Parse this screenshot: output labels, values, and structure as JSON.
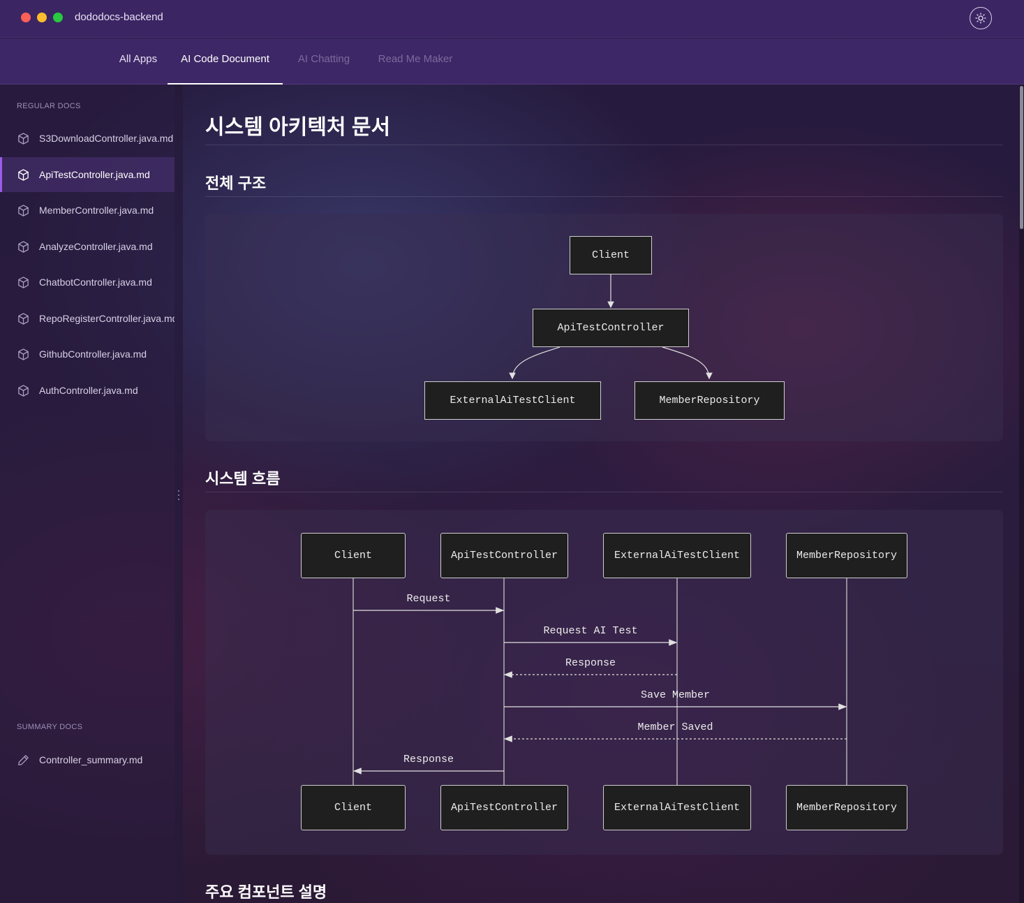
{
  "window": {
    "title": "dododocs-backend"
  },
  "nav": {
    "tabs": [
      {
        "label": "All Apps"
      },
      {
        "label": "AI Code Document"
      },
      {
        "label": "AI Chatting"
      },
      {
        "label": "Read Me Maker"
      }
    ],
    "active_tab": "AI Code Document"
  },
  "sidebar": {
    "regular_label": "REGULAR DOCS",
    "regular_items": [
      {
        "label": "S3DownloadController.java.md"
      },
      {
        "label": "ApiTestController.java.md"
      },
      {
        "label": "MemberController.java.md"
      },
      {
        "label": "AnalyzeController.java.md"
      },
      {
        "label": "ChatbotController.java.md"
      },
      {
        "label": "RepoRegisterController.java.md"
      },
      {
        "label": "GithubController.java.md"
      },
      {
        "label": "AuthController.java.md"
      }
    ],
    "active_item": "ApiTestController.java.md",
    "summary_label": "SUMMARY DOCS",
    "summary_items": [
      {
        "label": "Controller_summary.md"
      }
    ]
  },
  "document": {
    "title": "시스템 아키텍처 문서",
    "section1": "전체 구조",
    "section2": "시스템 흐름",
    "section3": "주요 컴포넌트 설명"
  },
  "structure_diagram": {
    "nodes": {
      "client": "Client",
      "controller": "ApiTestController",
      "ai_client": "ExternalAiTestClient",
      "repo": "MemberRepository"
    }
  },
  "sequence_diagram": {
    "participants": [
      "Client",
      "ApiTestController",
      "ExternalAiTestClient",
      "MemberRepository"
    ],
    "messages": [
      {
        "label": "Request",
        "from": "Client",
        "to": "ApiTestController",
        "style": "solid"
      },
      {
        "label": "Request AI Test",
        "from": "ApiTestController",
        "to": "ExternalAiTestClient",
        "style": "solid"
      },
      {
        "label": "Response",
        "from": "ExternalAiTestClient",
        "to": "ApiTestController",
        "style": "dashed"
      },
      {
        "label": "Save Member",
        "from": "ApiTestController",
        "to": "MemberRepository",
        "style": "solid"
      },
      {
        "label": "Member Saved",
        "from": "MemberRepository",
        "to": "ApiTestController",
        "style": "dashed"
      },
      {
        "label": "Response",
        "from": "ApiTestController",
        "to": "Client",
        "style": "solid"
      }
    ]
  },
  "colors": {
    "accent": "#9b5de5",
    "titlebar": "#3b2563",
    "node_fill": "#1f1f1f"
  }
}
